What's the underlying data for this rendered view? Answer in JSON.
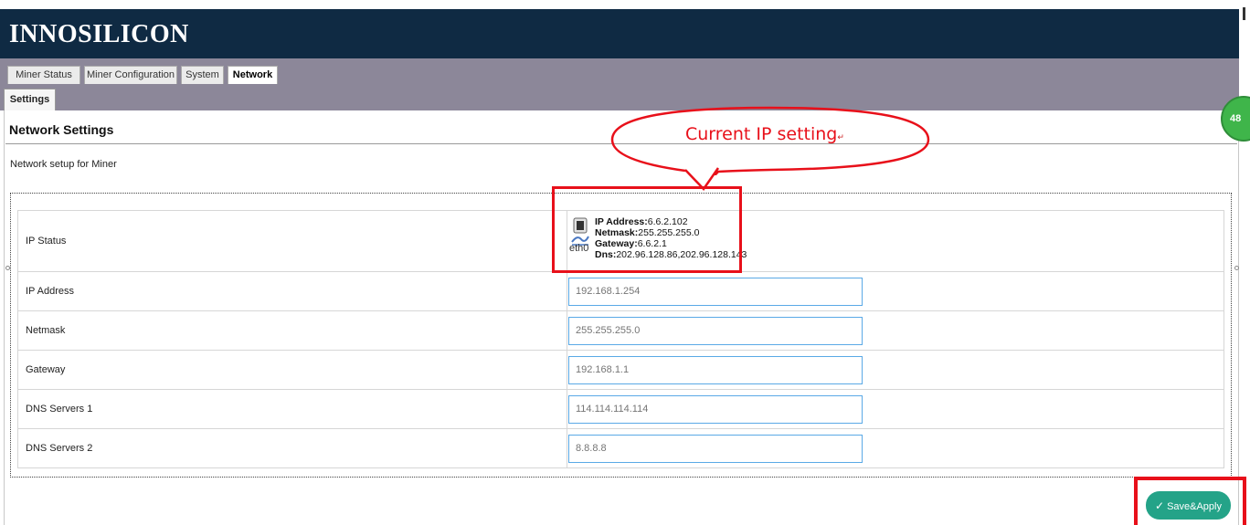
{
  "brand": {
    "logo_text": "INNOSILICON"
  },
  "tabs": [
    {
      "label": "Miner Status"
    },
    {
      "label": "Miner Configuration"
    },
    {
      "label": "System"
    },
    {
      "label": "Network",
      "active": true
    }
  ],
  "subtabs": [
    {
      "label": "Settings"
    }
  ],
  "page": {
    "title": "Network Settings",
    "description": "Network setup for Miner",
    "badge_text": "48"
  },
  "ip_status": {
    "label": "IP Status",
    "interface": "eth0",
    "ip_address_key": "IP Address:",
    "ip_address_value": "6.6.2.102",
    "netmask_key": "Netmask:",
    "netmask_value": "255.255.255.0",
    "gateway_key": "Gateway:",
    "gateway_value": "6.6.2.1",
    "dns_key": "Dns:",
    "dns_value": "202.96.128.86,202.96.128.143"
  },
  "fields": [
    {
      "label": "IP Address",
      "placeholder": "192.168.1.254"
    },
    {
      "label": "Netmask",
      "placeholder": "255.255.255.0"
    },
    {
      "label": "Gateway",
      "placeholder": "192.168.1.1"
    },
    {
      "label": "DNS Servers 1",
      "placeholder": "114.114.114.114"
    },
    {
      "label": "DNS Servers 2",
      "placeholder": "8.8.8.8"
    }
  ],
  "annotation": {
    "callout_text": "Current IP setting",
    "callout_mark": "↵"
  },
  "actions": {
    "save_label": "Save&Apply",
    "save_icon": "check-icon"
  },
  "colors": {
    "header_bg": "#0f2a43",
    "tabbar_bg": "#8c8799",
    "save_button": "#24a388",
    "highlight_red": "#e8101a",
    "field_border": "#5aa9e6"
  }
}
